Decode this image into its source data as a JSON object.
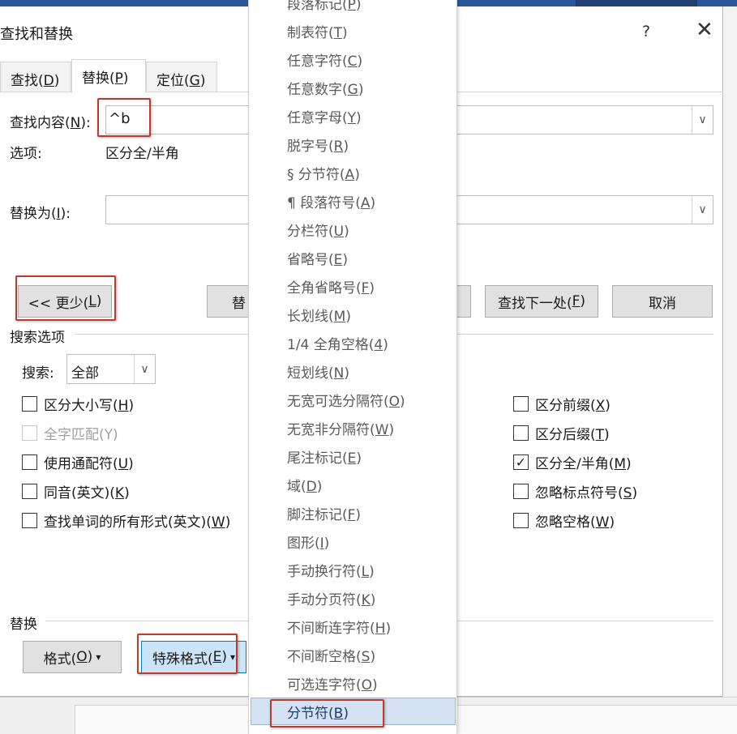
{
  "dialog": {
    "title": "查找和替换",
    "help": "?",
    "close": "✕",
    "tabs": [
      {
        "label": "查找(",
        "key": "D",
        "end": ")"
      },
      {
        "label": "替换(",
        "key": "P",
        "end": ")"
      },
      {
        "label": "定位(",
        "key": "G",
        "end": ")"
      }
    ]
  },
  "find": {
    "label": "查找内容(",
    "key": "N",
    "end": "):",
    "value": "^b"
  },
  "options": {
    "label": "选项:",
    "value": "区分全/半角"
  },
  "replace": {
    "label": "替换为(",
    "key": "I",
    "end": "):",
    "value": ""
  },
  "buttons": {
    "less": {
      "label": "<< 更少(",
      "key": "L",
      "end": ")"
    },
    "replace_partial": "替",
    "find_next": {
      "label": "查找下一处(",
      "key": "F",
      "end": ")"
    },
    "cancel": "取消",
    "format": {
      "label": "格式(",
      "key": "O",
      "end": ")",
      "arrow": "▾"
    },
    "special": {
      "label": "特殊格式(",
      "key": "E",
      "end": ")",
      "arrow": "▾"
    }
  },
  "search_options": {
    "section_title": "搜索选项",
    "search_label": "搜索:",
    "search_value": "全部",
    "left_checks": [
      {
        "label": "区分大小写(",
        "key": "H",
        "end": ")",
        "checked": false,
        "disabled": false
      },
      {
        "label": "全字匹配(",
        "key": "Y",
        "end": ")",
        "checked": false,
        "disabled": true
      },
      {
        "label": "使用通配符(",
        "key": "U",
        "end": ")",
        "checked": false,
        "disabled": false
      },
      {
        "label": "同音(英文)(",
        "key": "K",
        "end": ")",
        "checked": false,
        "disabled": false
      },
      {
        "label": "查找单词的所有形式(英文)(",
        "key": "W",
        "end": ")",
        "checked": false,
        "disabled": false
      }
    ],
    "right_checks": [
      {
        "label": "区分前缀(",
        "key": "X",
        "end": ")",
        "checked": false
      },
      {
        "label": "区分后缀(",
        "key": "T",
        "end": ")",
        "checked": false
      },
      {
        "label": "区分全/半角(",
        "key": "M",
        "end": ")",
        "checked": true
      },
      {
        "label": "忽略标点符号(",
        "key": "S",
        "end": ")",
        "checked": false
      },
      {
        "label": "忽略空格(",
        "key": "W",
        "end": ")",
        "checked": false
      }
    ]
  },
  "replace_section": {
    "title": "替换"
  },
  "menu": {
    "items": [
      {
        "label": "段落标记(",
        "key": "P",
        "end": ")"
      },
      {
        "label": "制表符(",
        "key": "T",
        "end": ")"
      },
      {
        "label": "任意字符(",
        "key": "C",
        "end": ")"
      },
      {
        "label": "任意数字(",
        "key": "G",
        "end": ")"
      },
      {
        "label": "任意字母(",
        "key": "Y",
        "end": ")"
      },
      {
        "label": "脱字号(",
        "key": "R",
        "end": ")"
      },
      {
        "label": "§ 分节符(",
        "key": "A",
        "end": ")"
      },
      {
        "label": "¶ 段落符号(",
        "key": "A",
        "end": ")"
      },
      {
        "label": "分栏符(",
        "key": "U",
        "end": ")"
      },
      {
        "label": "省略号(",
        "key": "E",
        "end": ")"
      },
      {
        "label": "全角省略号(",
        "key": "F",
        "end": ")"
      },
      {
        "label": "长划线(",
        "key": "M",
        "end": ")"
      },
      {
        "label": "1/4 全角空格(",
        "key": "4",
        "end": ")"
      },
      {
        "label": "短划线(",
        "key": "N",
        "end": ")"
      },
      {
        "label": "无宽可选分隔符(",
        "key": "O",
        "end": ")"
      },
      {
        "label": "无宽非分隔符(",
        "key": "W",
        "end": ")"
      },
      {
        "label": "尾注标记(",
        "key": "E",
        "end": ")"
      },
      {
        "label": "域(",
        "key": "D",
        "end": ")"
      },
      {
        "label": "脚注标记(",
        "key": "F",
        "end": ")"
      },
      {
        "label": "图形(",
        "key": "I",
        "end": ")"
      },
      {
        "label": "手动换行符(",
        "key": "L",
        "end": ")"
      },
      {
        "label": "手动分页符(",
        "key": "K",
        "end": ")"
      },
      {
        "label": "不间断连字符(",
        "key": "H",
        "end": ")"
      },
      {
        "label": "不间断空格(",
        "key": "S",
        "end": ")"
      },
      {
        "label": "可选连字符(",
        "key": "O",
        "end": ")"
      },
      {
        "label": "分节符(",
        "key": "B",
        "end": ")"
      }
    ],
    "highlight_color": "#d4e2f4"
  },
  "colors": {
    "accent": "#2b579a",
    "annotation_red": "#c0392b"
  }
}
